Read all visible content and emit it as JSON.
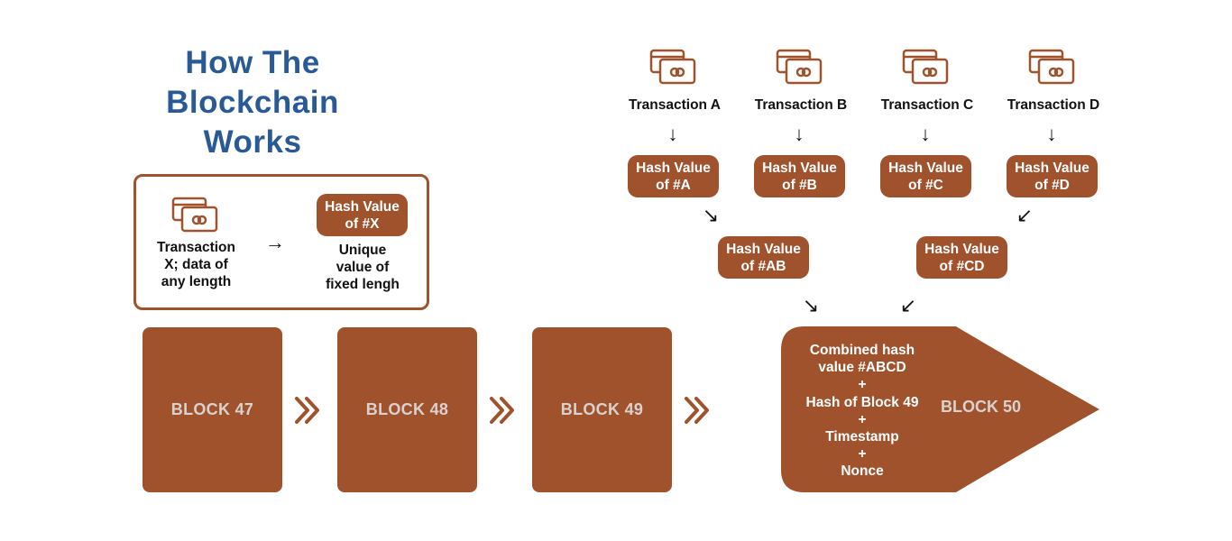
{
  "title": {
    "line1": "How The",
    "line2": "Blockchain",
    "line3": "Works"
  },
  "colors": {
    "title": "#2a5a96",
    "accent": "#a0522d",
    "block_label": "#d9d2cf"
  },
  "legend": {
    "icon": "credit-cards-icon",
    "transaction_line1": "Transaction",
    "transaction_line2": "X; data of",
    "transaction_line3": "any length",
    "arrow": "→",
    "hash_line1": "Hash Value",
    "hash_line2": "of #X",
    "desc_line1": "Unique",
    "desc_line2": "value of",
    "desc_line3": "fixed lengh"
  },
  "transactions": [
    {
      "label": "Transaction A",
      "hash_line1": "Hash Value",
      "hash_line2": "of #A",
      "arrow": "↓"
    },
    {
      "label": "Transaction B",
      "hash_line1": "Hash Value",
      "hash_line2": "of #B",
      "arrow": "↓"
    },
    {
      "label": "Transaction C",
      "hash_line1": "Hash Value",
      "hash_line2": "of #C",
      "arrow": "↓"
    },
    {
      "label": "Transaction D",
      "hash_line1": "Hash Value",
      "hash_line2": "of #D",
      "arrow": "↓"
    }
  ],
  "pair_hashes": [
    {
      "line1": "Hash Value",
      "line2": "of #AB",
      "arrow_in": "↘",
      "arrow_out": "↘"
    },
    {
      "line1": "Hash Value",
      "line2": "of #CD",
      "arrow_in": "↙",
      "arrow_out": "↙"
    }
  ],
  "blocks": [
    {
      "label": "BLOCK 47"
    },
    {
      "label": "BLOCK 48"
    },
    {
      "label": "BLOCK 49"
    }
  ],
  "block50": {
    "label": "BLOCK 50",
    "lines": [
      "Combined hash",
      "value #ABCD",
      "+",
      "Hash of Block 49",
      "+",
      "Timestamp",
      "+",
      "Nonce"
    ]
  }
}
